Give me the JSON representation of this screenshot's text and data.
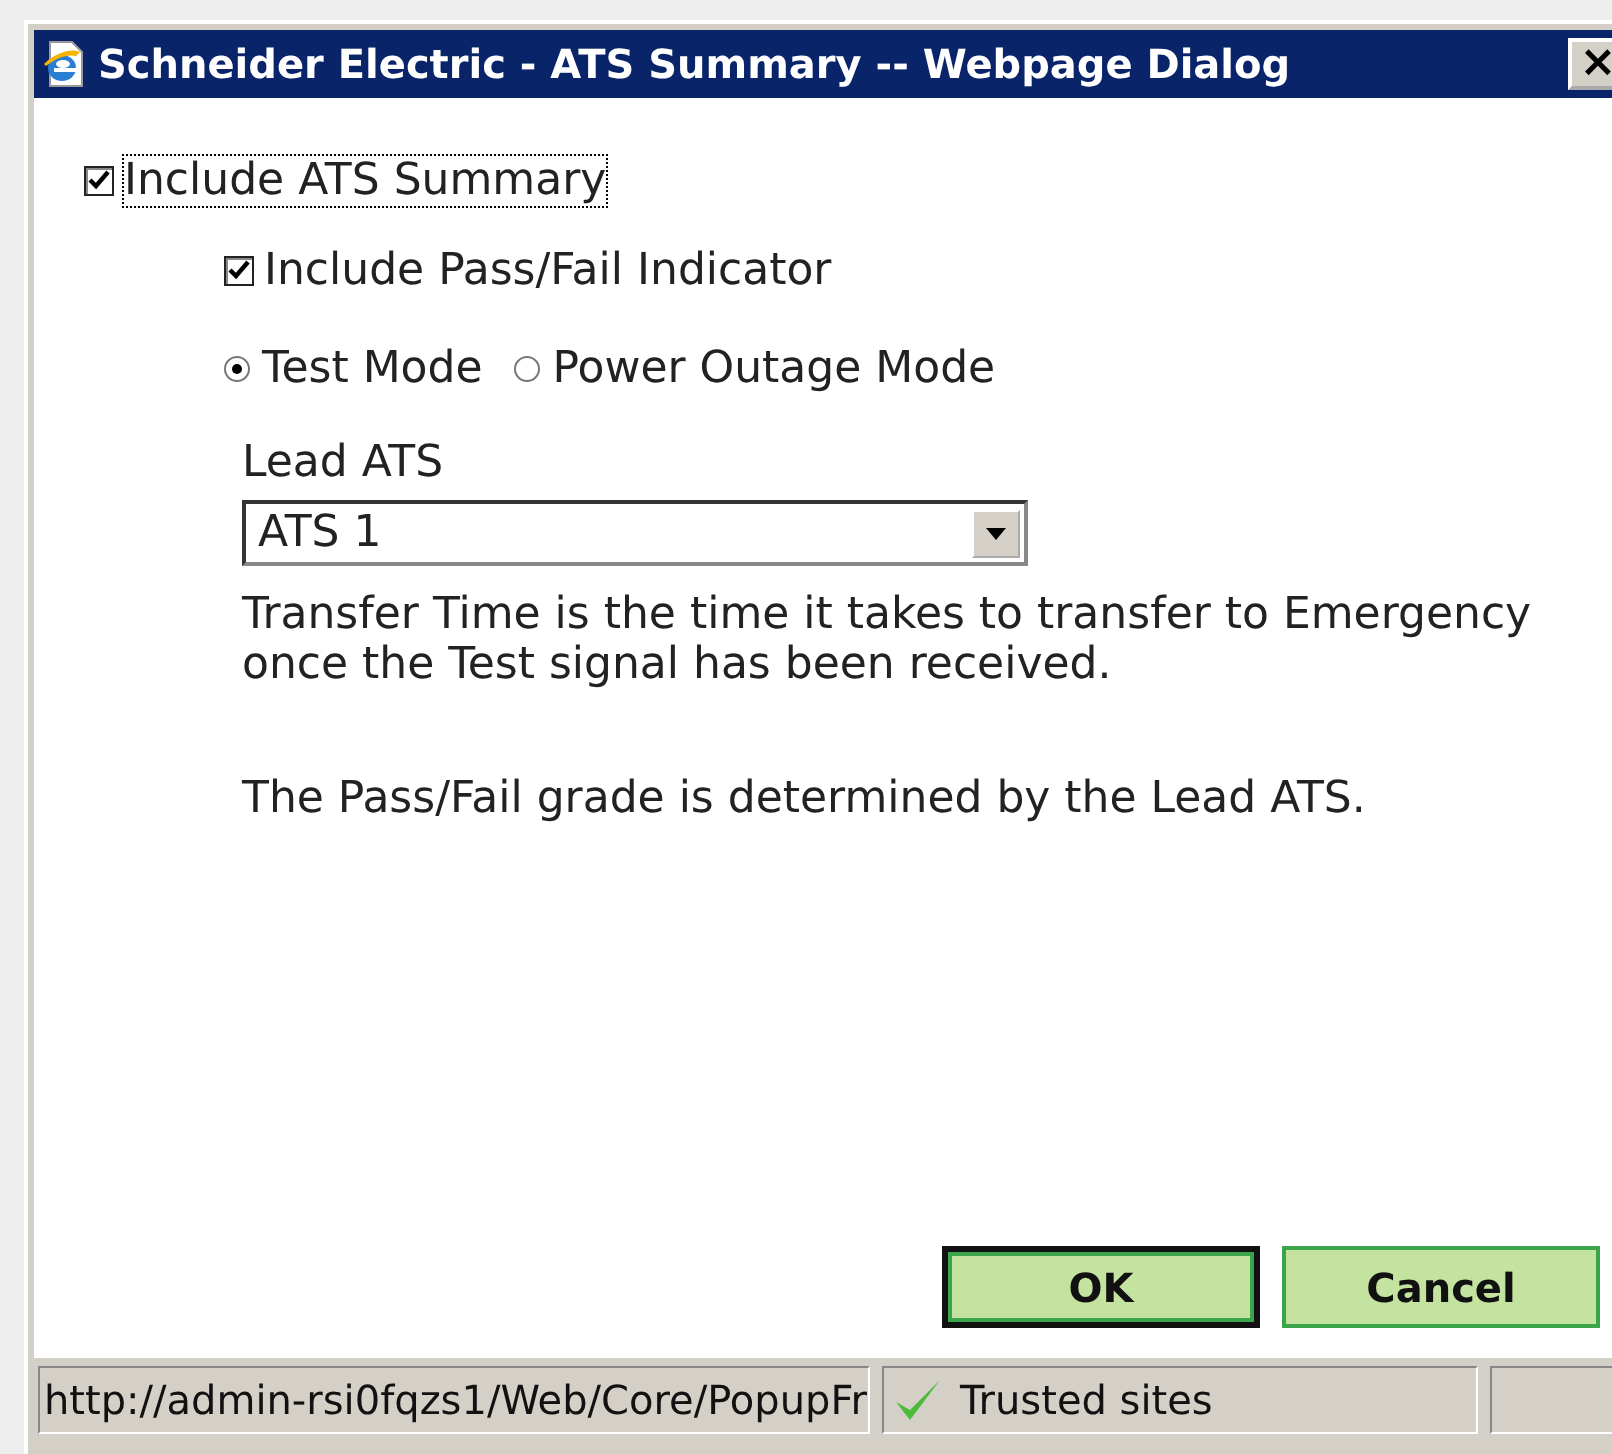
{
  "window": {
    "title": "Schneider Electric - ATS Summary -- Webpage Dialog",
    "close": "×"
  },
  "include_summary": {
    "label": "Include ATS Summary",
    "checked": true
  },
  "include_indicator": {
    "label": "Include Pass/Fail Indicator",
    "checked": true
  },
  "modes": [
    {
      "label": "Test Mode",
      "selected": true
    },
    {
      "label": "Power Outage Mode",
      "selected": false
    }
  ],
  "lead_ats": {
    "label": "Lead ATS",
    "value": "ATS 1"
  },
  "notes": [
    "Transfer Time is the time it takes to transfer to Emergency once the Test signal has been received.",
    "The Pass/Fail grade is determined by the Lead ATS."
  ],
  "buttons": [
    {
      "label": "OK",
      "default": true
    },
    {
      "label": "Cancel",
      "default": false
    }
  ],
  "status_bar": {
    "url": "http://admin-rsi0fqzs1/Web/Core/PopupFr",
    "zone": "Trusted sites"
  }
}
